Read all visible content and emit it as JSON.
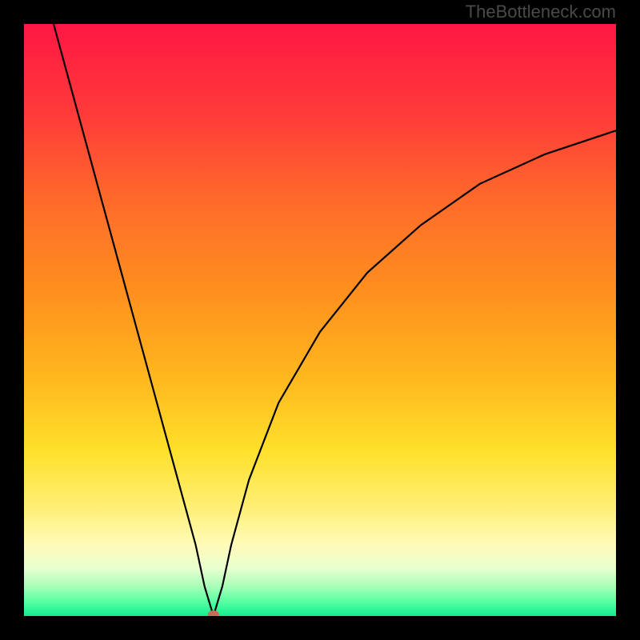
{
  "watermark": "TheBottleneck.com",
  "chart_data": {
    "type": "line",
    "title": "",
    "xlabel": "",
    "ylabel": "",
    "xlim": [
      0,
      100
    ],
    "ylim": [
      0,
      100
    ],
    "curve": {
      "description": "V-shaped bottleneck curve with minimum around x=32",
      "x": [
        5,
        8,
        11,
        14,
        17,
        20,
        23,
        26,
        29,
        30.5,
        32,
        33.5,
        35,
        38,
        43,
        50,
        58,
        67,
        77,
        88,
        100
      ],
      "y": [
        100,
        89,
        78,
        67,
        56,
        45,
        34,
        23,
        12,
        5,
        0,
        5,
        12,
        23,
        36,
        48,
        58,
        66,
        73,
        78,
        82
      ]
    },
    "marker": {
      "x": 32,
      "y": 0,
      "color": "#c96a5a"
    },
    "gradient_stops": [
      {
        "offset": 0.0,
        "color": "#ff1744"
      },
      {
        "offset": 0.15,
        "color": "#ff3a3a"
      },
      {
        "offset": 0.3,
        "color": "#ff6b2a"
      },
      {
        "offset": 0.45,
        "color": "#ff8f1e"
      },
      {
        "offset": 0.6,
        "color": "#ffb81e"
      },
      {
        "offset": 0.72,
        "color": "#ffe02a"
      },
      {
        "offset": 0.82,
        "color": "#fff078"
      },
      {
        "offset": 0.88,
        "color": "#fffbb8"
      },
      {
        "offset": 0.92,
        "color": "#e8ffd0"
      },
      {
        "offset": 0.95,
        "color": "#a8ffb8"
      },
      {
        "offset": 0.98,
        "color": "#4affa0"
      },
      {
        "offset": 1.0,
        "color": "#15ea8f"
      }
    ]
  }
}
